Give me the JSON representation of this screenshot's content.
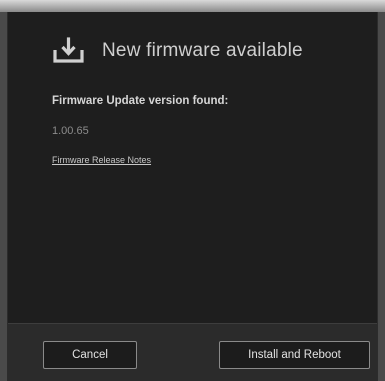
{
  "dialog": {
    "title": "New firmware available",
    "icon": "download-icon",
    "found_label": "Firmware Update version found:",
    "version": "1.00.65",
    "release_notes_link": "Firmware Release Notes"
  },
  "footer": {
    "cancel_label": "Cancel",
    "install_label": "Install and Reboot"
  },
  "colors": {
    "dialog_background": "#1e1e1e",
    "footer_background": "#2b2b2b",
    "title_text": "#cfcfcf",
    "button_border": "#8a8a8a"
  }
}
